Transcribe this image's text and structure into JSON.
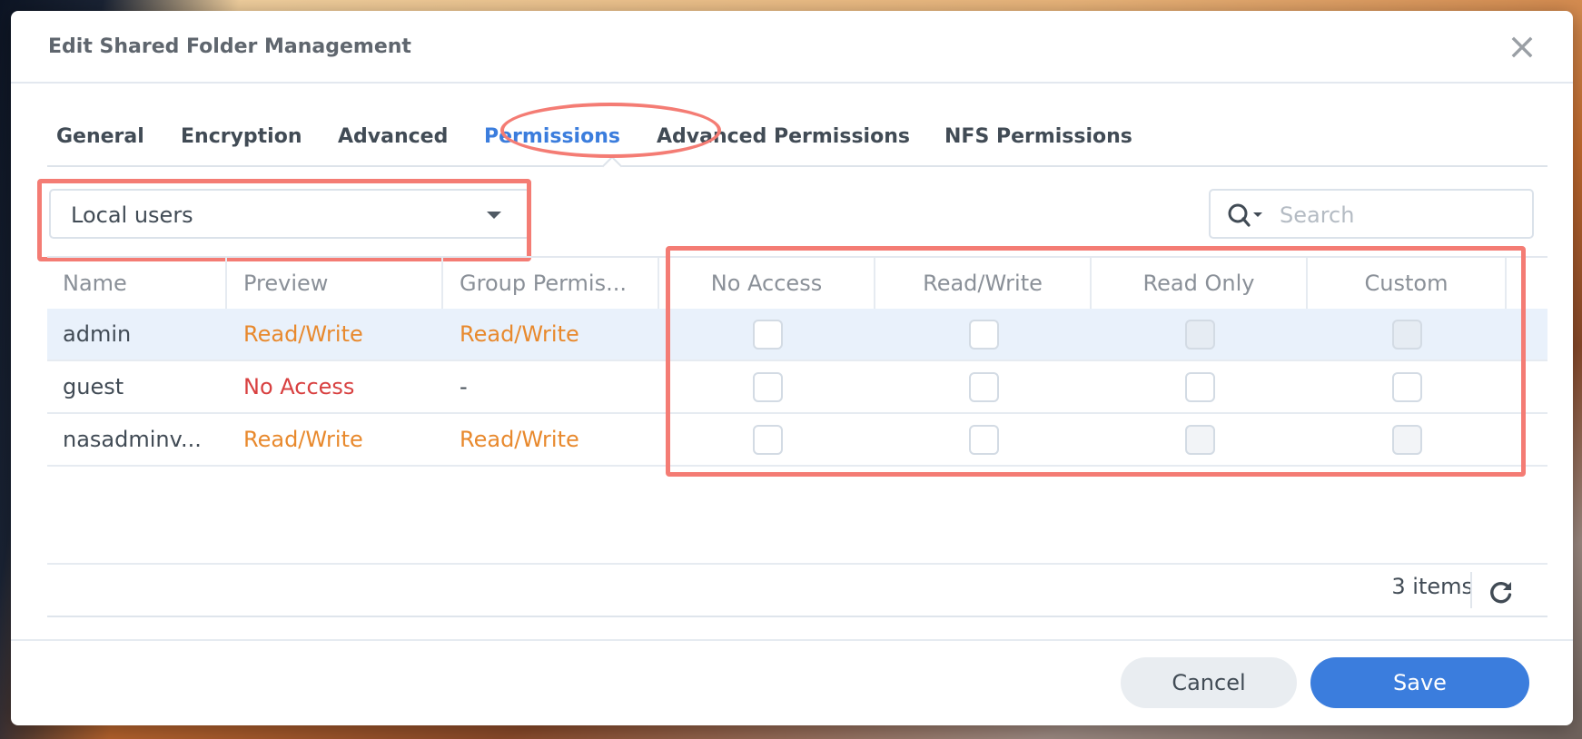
{
  "dialog": {
    "title": "Edit Shared Folder Management",
    "close_icon": "close-icon"
  },
  "tabs": [
    {
      "label": "General",
      "active": false
    },
    {
      "label": "Encryption",
      "active": false
    },
    {
      "label": "Advanced",
      "active": false
    },
    {
      "label": "Permissions",
      "active": true
    },
    {
      "label": "Advanced Permissions",
      "active": false
    },
    {
      "label": "NFS Permissions",
      "active": false
    }
  ],
  "toolbar": {
    "user_type_selected": "Local users",
    "search_placeholder": "Search",
    "search_value": "",
    "search_icon": "search-icon"
  },
  "table": {
    "columns": [
      "Name",
      "Preview",
      "Group Permis...",
      "No Access",
      "Read/Write",
      "Read Only",
      "Custom"
    ],
    "rows": [
      {
        "name": "admin",
        "preview": "Read/Write",
        "group": "Read/Write",
        "selected": true,
        "no_access": false,
        "read_write": false,
        "read_only": false,
        "custom": false,
        "disabled": [
          "read_only",
          "custom"
        ]
      },
      {
        "name": "guest",
        "preview": "No Access",
        "group": "-",
        "selected": false,
        "no_access": false,
        "read_write": false,
        "read_only": false,
        "custom": false,
        "disabled": []
      },
      {
        "name": "nasadminv...",
        "preview": "Read/Write",
        "group": "Read/Write",
        "selected": false,
        "no_access": false,
        "read_write": false,
        "read_only": false,
        "custom": false,
        "disabled": [
          "read_only",
          "custom"
        ]
      }
    ]
  },
  "footer": {
    "item_count": "3 items",
    "refresh_icon": "refresh-icon"
  },
  "buttons": {
    "cancel": "Cancel",
    "save": "Save"
  },
  "colors": {
    "accent": "#3b7ddd",
    "read_write": "#e8892d",
    "no_access": "#d84040",
    "annotation": "#f47c74"
  }
}
